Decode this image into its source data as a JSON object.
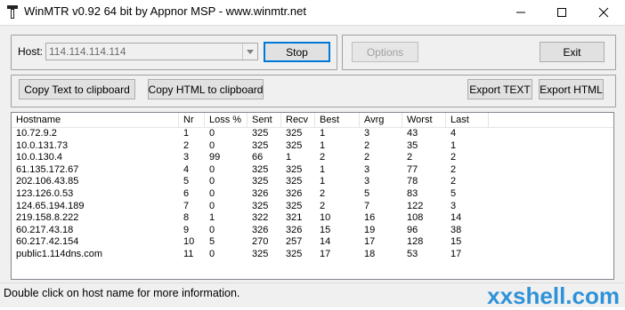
{
  "window": {
    "title": "WinMTR v0.92 64 bit by Appnor MSP - www.winmtr.net"
  },
  "controls": {
    "host_label": "Host:",
    "host_value": "114.114.114.114",
    "stop_label": "Stop",
    "options_label": "Options",
    "exit_label": "Exit",
    "copy_text_label": "Copy Text to clipboard",
    "copy_html_label": "Copy HTML to clipboard",
    "export_text_label": "Export TEXT",
    "export_html_label": "Export HTML"
  },
  "table": {
    "columns": [
      "Hostname",
      "Nr",
      "Loss %",
      "Sent",
      "Recv",
      "Best",
      "Avrg",
      "Worst",
      "Last"
    ],
    "rows": [
      [
        "10.72.9.2",
        "1",
        "0",
        "325",
        "325",
        "1",
        "3",
        "43",
        "4"
      ],
      [
        "10.0.131.73",
        "2",
        "0",
        "325",
        "325",
        "1",
        "2",
        "35",
        "1"
      ],
      [
        "10.0.130.4",
        "3",
        "99",
        "66",
        "1",
        "2",
        "2",
        "2",
        "2"
      ],
      [
        "61.135.172.67",
        "4",
        "0",
        "325",
        "325",
        "1",
        "3",
        "77",
        "2"
      ],
      [
        "202.106.43.85",
        "5",
        "0",
        "325",
        "325",
        "1",
        "3",
        "78",
        "2"
      ],
      [
        "123.126.0.53",
        "6",
        "0",
        "326",
        "326",
        "2",
        "5",
        "83",
        "5"
      ],
      [
        "124.65.194.189",
        "7",
        "0",
        "325",
        "325",
        "2",
        "7",
        "122",
        "3"
      ],
      [
        "219.158.8.222",
        "8",
        "1",
        "322",
        "321",
        "10",
        "16",
        "108",
        "14"
      ],
      [
        "60.217.43.18",
        "9",
        "0",
        "326",
        "326",
        "15",
        "19",
        "96",
        "38"
      ],
      [
        "60.217.42.154",
        "10",
        "5",
        "270",
        "257",
        "14",
        "17",
        "128",
        "15"
      ],
      [
        "public1.114dns.com",
        "11",
        "0",
        "325",
        "325",
        "17",
        "18",
        "53",
        "17"
      ]
    ]
  },
  "status": {
    "text": "Double click on host name for more information."
  },
  "watermark": {
    "text": "xxshell.com"
  }
}
